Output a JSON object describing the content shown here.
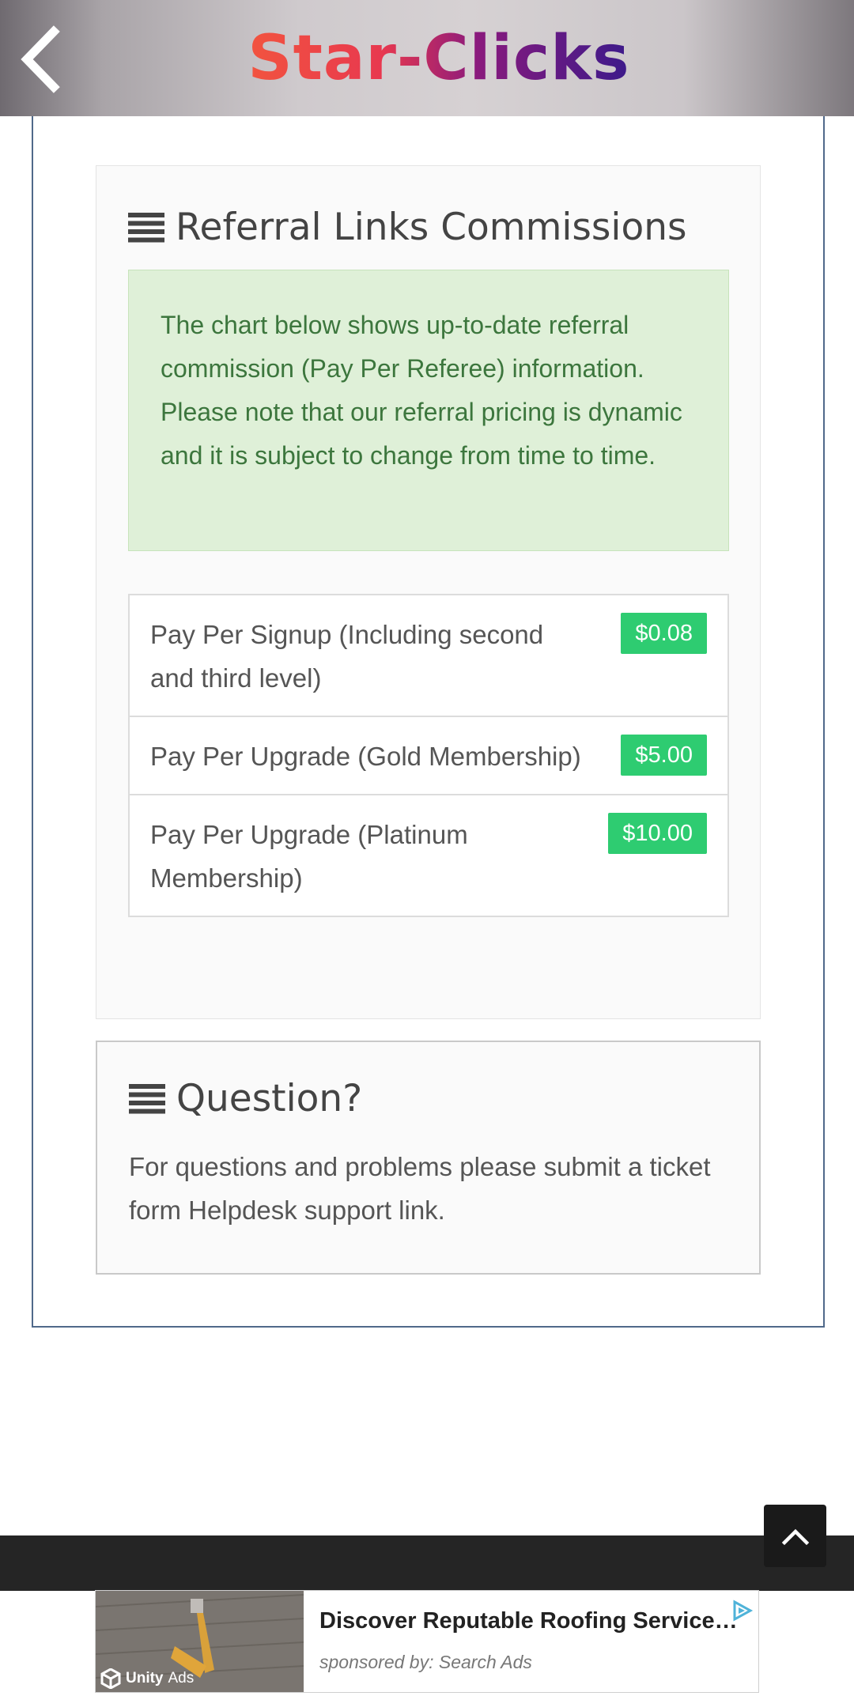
{
  "header": {
    "logo_text": "Star-Clicks",
    "back_icon": "chevron-left-icon"
  },
  "referral": {
    "title": "Referral Links Commissions",
    "title_icon": "bars-icon",
    "notice": "The chart below shows up-to-date referral commission (Pay Per Referee) information. Please note that our referral pricing is dynamic and it is subject to change from time to time.",
    "items": [
      {
        "label": "Pay Per Signup (Including second and third level)",
        "amount": "$0.08"
      },
      {
        "label": "Pay Per Upgrade (Gold Membership)",
        "amount": "$5.00"
      },
      {
        "label": "Pay Per Upgrade (Platinum Membership)",
        "amount": "$10.00"
      }
    ]
  },
  "question": {
    "title": "Question?",
    "title_icon": "bars-icon",
    "text": "For questions and problems please submit a ticket form Helpdesk support link."
  },
  "scroll_top": {
    "icon": "chevron-up-icon"
  },
  "ad": {
    "title": "Discover Reputable Roofing Services…",
    "sponsor": "sponsored by: Search Ads",
    "brand": "Unity",
    "brand_suffix": "Ads",
    "choice_icon": "ad-choices-icon"
  },
  "colors": {
    "accent_badge": "#2ecc71",
    "notice_bg": "#dff0d8",
    "notice_text": "#3c763d",
    "frame_border": "#50698a",
    "footer": "#252525"
  }
}
